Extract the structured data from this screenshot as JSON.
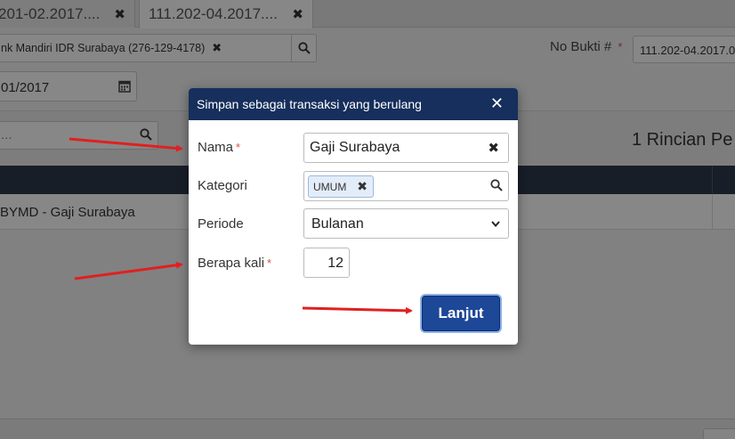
{
  "tabs": [
    {
      "label": "201-02.2017...."
    },
    {
      "label": "111.202-04.2017...."
    }
  ],
  "account_field": {
    "value": "nk Mandiri IDR Surabaya (276-129-4178)"
  },
  "nobukti": {
    "label": "No Bukti #",
    "value": "111.202-04.2017.0"
  },
  "date_field": {
    "value": "01/2017"
  },
  "search_field": {
    "placeholder": "..."
  },
  "rincian_label": "1 Rincian Pe",
  "table": {
    "rows": [
      {
        "text": "BYMD - Gaji Surabaya"
      }
    ]
  },
  "modal": {
    "title": "Simpan sebagai transaksi yang berulang",
    "fields": {
      "nama": {
        "label": "Nama",
        "required": "*",
        "value": "Gaji Surabaya"
      },
      "kategori": {
        "label": "Kategori",
        "chip": "UMUM"
      },
      "periode": {
        "label": "Periode",
        "value": "Bulanan"
      },
      "berapa_kali": {
        "label": "Berapa kali",
        "required": "*",
        "value": "12"
      }
    },
    "submit_label": "Lanjut"
  },
  "colors": {
    "modal_header": "#162f5c",
    "primary_button": "#1d4797",
    "required": "#d9534f",
    "annotation_arrow": "#e02020"
  }
}
